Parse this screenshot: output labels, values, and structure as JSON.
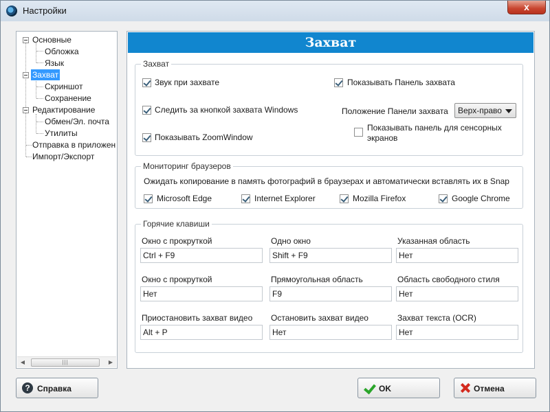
{
  "window": {
    "title": "Настройки",
    "close_glyph": "x"
  },
  "tree": {
    "items": [
      {
        "label": "Основные"
      },
      {
        "label": "Обложка"
      },
      {
        "label": "Язык"
      },
      {
        "label": "Захват"
      },
      {
        "label": "Скриншот"
      },
      {
        "label": "Сохранение"
      },
      {
        "label": "Редактирование"
      },
      {
        "label": "Обмен/Эл. почта"
      },
      {
        "label": "Утилиты"
      },
      {
        "label": "Отправка в приложен"
      },
      {
        "label": "Импорт/Экспорт"
      }
    ],
    "selected": "Захват",
    "scroll_left": "◀",
    "scroll_right": "▶",
    "scroll_grip": "|||"
  },
  "header": {
    "title": "Захват"
  },
  "capture": {
    "legend": "Захват",
    "sound": "Звук при захвате",
    "show_panel": "Показывать Панель захвата",
    "follow_button": "Следить за кнопкой захвата Windows",
    "panel_position_label": "Положение Панели захвата",
    "panel_position_value": "Верх-право",
    "show_zoom": "Показывать ZoomWindow",
    "show_touch_panel_line1": "Показывать панель для сенсорных",
    "show_touch_panel_line2": "экранов"
  },
  "browser": {
    "legend": "Мониторинг браузеров",
    "description": "Ожидать копирование в память фотографий в браузерах и автоматически вставлять их в Snap",
    "browsers": [
      "Microsoft Edge",
      "Internet Explorer",
      "Mozilla Firefox",
      "Google Chrome"
    ]
  },
  "hotkeys": {
    "legend": "Горячие клавиши",
    "items": [
      {
        "label": "Окно с прокруткой",
        "value": "Ctrl + F9"
      },
      {
        "label": "Одно окно",
        "value": "Shift + F9"
      },
      {
        "label": "Указанная область",
        "value": "Нет"
      },
      {
        "label": "Окно с прокруткой",
        "value": "Нет"
      },
      {
        "label": "Прямоугольная область",
        "value": "F9"
      },
      {
        "label": "Область свободного стиля",
        "value": "Нет"
      },
      {
        "label": "Приостановить захват видео",
        "value": "Alt + P"
      },
      {
        "label": "Остановить захват видео",
        "value": "Нет"
      },
      {
        "label": "Захват текста (OCR)",
        "value": "Нет"
      }
    ]
  },
  "buttons": {
    "help": "Справка",
    "ok": "OK",
    "cancel": "Отмена",
    "help_glyph": "?"
  }
}
